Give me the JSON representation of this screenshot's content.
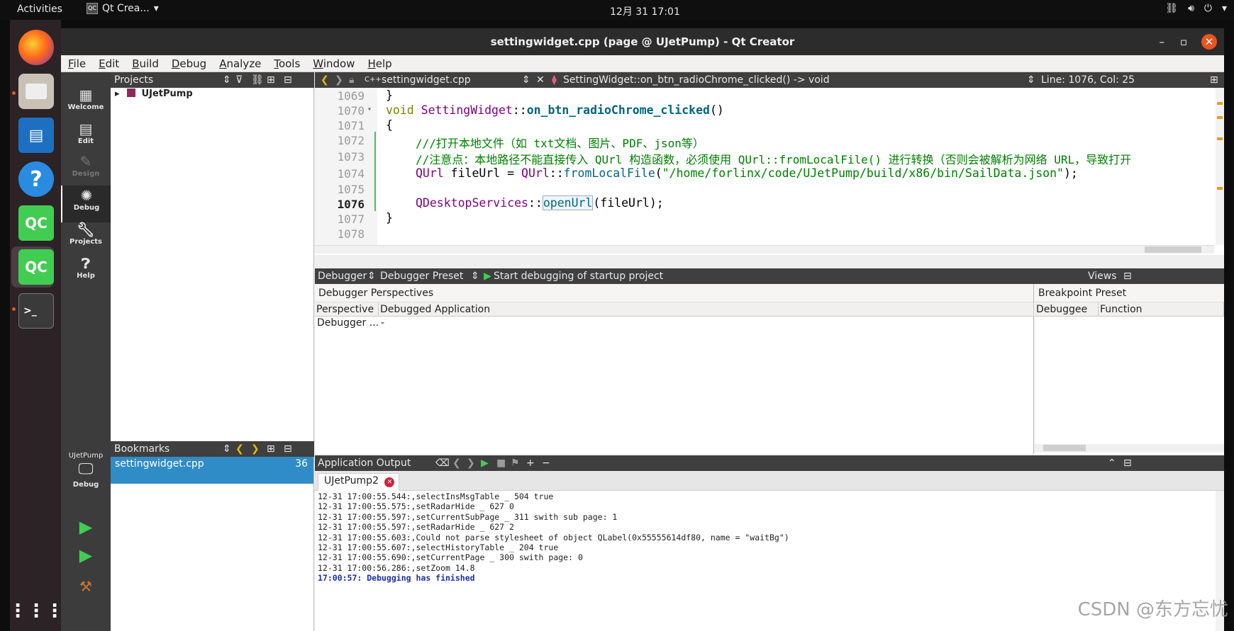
{
  "topbar": {
    "activities": "Activities",
    "app_name": "Qt Crea...",
    "app_badge": "QC",
    "clock": "12月 31  17:01"
  },
  "window": {
    "title": "settingwidget.cpp (page @ UJetPump) - Qt Creator"
  },
  "menu": [
    "File",
    "Edit",
    "Build",
    "Debug",
    "Analyze",
    "Tools",
    "Window",
    "Help"
  ],
  "modes": [
    {
      "label": "Welcome",
      "icon": "grid-icon"
    },
    {
      "label": "Edit",
      "icon": "document-icon"
    },
    {
      "label": "Design",
      "icon": "pencil-icon"
    },
    {
      "label": "Debug",
      "icon": "bug-icon"
    },
    {
      "label": "Projects",
      "icon": "wrench-icon"
    },
    {
      "label": "Help",
      "icon": "help-icon"
    }
  ],
  "kit": {
    "project": "UJetPump",
    "config": "Debug"
  },
  "projects": {
    "header": "Projects",
    "root": "UJetPump"
  },
  "bookmarks": {
    "header": "Bookmarks",
    "items": [
      {
        "file": "settingwidget.cpp",
        "line": "36"
      }
    ]
  },
  "editor": {
    "file_tab": "settingwidget.cpp",
    "symbol": "SettingWidget::on_btn_radioChrome_clicked() -> void",
    "cursor": "Line: 1076, Col: 25",
    "lines": [
      "1069",
      "1070",
      "1071",
      "1072",
      "1073",
      "1074",
      "1075",
      "1076",
      "1077",
      "1078"
    ],
    "code": {
      "l1069": "}",
      "l1070_kw": "void ",
      "l1070_cls": "SettingWidget",
      "l1070_sep": "::",
      "l1070_fn": "on_btn_radioChrome_clicked",
      "l1070_tail": "()",
      "l1071": "{",
      "l1072": "///打开本地文件（如 txt文档、图片、PDF、json等）",
      "l1073": "//注意点：本地路径不能直接传入 QUrl 构造函数，必须使用 QUrl::fromLocalFile() 进行转换（否则会被解析为网络 URL，导致打开",
      "l1074_cls": "QUrl",
      "l1074_var": " fileUrl = ",
      "l1074_cls2": "QUrl",
      "l1074_sep": "::",
      "l1074_fn": "fromLocalFile",
      "l1074_open": "(",
      "l1074_str": "\"/home/forlinx/code/UJetPump/build/x86/bin/SailData.json\"",
      "l1074_close": ");",
      "l1076_cls": "QDesktopServices",
      "l1076_sep": "::",
      "l1076_fn": "openUrl",
      "l1076_args": "(fileUrl);",
      "l1077": "}"
    }
  },
  "debugger": {
    "combo1": "Debugger",
    "combo2": "Debugger Preset",
    "start": "Start debugging of startup project",
    "views": "Views",
    "perspectives_title": "Debugger Perspectives",
    "columns": [
      "Perspective",
      "Debugged Application"
    ],
    "row": [
      "Debugger ...",
      "-"
    ],
    "breakpoint_title": "Breakpoint Preset",
    "bp_columns": [
      "Debuggee",
      "Function"
    ]
  },
  "output": {
    "header": "Application Output",
    "tab": "UJetPump2",
    "lines": [
      "12-31 17:00:55.544:,selectInsMsgTable _ 504 true",
      "12-31 17:00:55.575:,setRadarHide _ 627 0",
      "12-31 17:00:55.597:,setCurrentSubPage _ 311 swith sub page: 1",
      "12-31 17:00:55.597:,setRadarHide _ 627 2",
      "12-31 17:00:55.603:,Could not parse stylesheet of object QLabel(0x55555614df80, name = \"waitBg\")",
      "12-31 17:00:55.607:,selectHistoryTable _ 204 true",
      "12-31 17:00:55.690:,setCurrentPage _ 300 swith page: 0",
      "12-31 17:00:56.286:,setZoom 14.8"
    ],
    "finished": "17:00:57: Debugging has finished"
  },
  "watermark": "CSDN @东方忘忧",
  "colors": {
    "accent": "#308cc6",
    "dock": "#2b2326",
    "panel": "#3f3f3f",
    "close": "#e95420"
  }
}
